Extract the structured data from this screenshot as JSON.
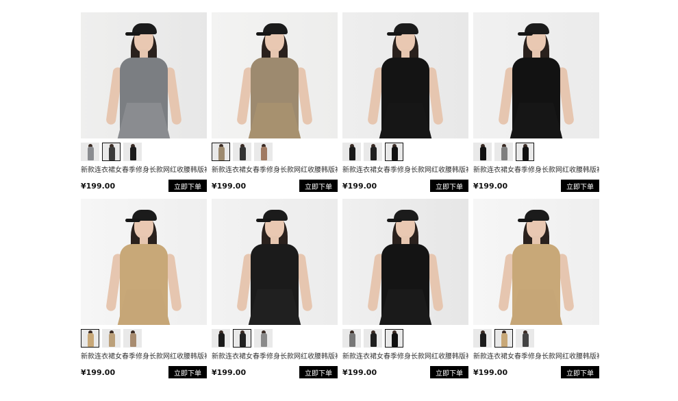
{
  "products": [
    {
      "title": "新款连衣裙女春季修身长款网红收腰韩版裙...",
      "price": "¥199.00",
      "buy_label": "立即下单",
      "bg": "#e7e7e7",
      "wall": "#efefee",
      "dress": "#7b7e82",
      "skirt": "#8a8c90",
      "thumbs": [
        "#8a8c90",
        "#3b3b3b",
        "#1a1a1a"
      ],
      "active_thumb": 1
    },
    {
      "title": "新款连衣裙女春季修身长款网红收腰韩版裙...",
      "price": "¥199.00",
      "buy_label": "立即下单",
      "bg": "#ededec",
      "wall": "#f3f3f2",
      "dress": "#9d8a6f",
      "skirt": "#a7916f",
      "thumbs": [
        "#9d8a6f",
        "#333333",
        "#a07a62"
      ],
      "active_thumb": 0
    },
    {
      "title": "新款连衣裙女春季修身长款网红收腰韩版裙...",
      "price": "¥199.00",
      "buy_label": "立即下单",
      "bg": "#e8e8e8",
      "wall": "#eeeeee",
      "dress": "#141414",
      "skirt": "#161616",
      "thumbs": [
        "#1a1a1a",
        "#202020",
        "#111111"
      ],
      "active_thumb": 2
    },
    {
      "title": "新款连衣裙女春季修身长款网红收腰韩版裙...",
      "price": "¥199.00",
      "buy_label": "立即下单",
      "bg": "#ebebeb",
      "wall": "#f1f1f1",
      "dress": "#121212",
      "skirt": "#161616",
      "thumbs": [
        "#121212",
        "#7f7f7f",
        "#111111"
      ],
      "active_thumb": 2
    },
    {
      "title": "新款连衣裙女春季修身长款网红收腰韩版裙...",
      "price": "¥199.00",
      "buy_label": "立即下单",
      "bg": "#efefef",
      "wall": "#f6f6f6",
      "dress": "#c8a878",
      "skirt": "#c6a677",
      "thumbs": [
        "#c8a878",
        "#bba07a",
        "#a88c70"
      ],
      "active_thumb": 0
    },
    {
      "title": "新款连衣裙女春季修身长款网红收腰韩版裙...",
      "price": "¥199.00",
      "buy_label": "立即下单",
      "bg": "#ececec",
      "wall": "#f2f2f2",
      "dress": "#1b1b1b",
      "skirt": "#202020",
      "thumbs": [
        "#1b1b1b",
        "#222222",
        "#8a8a8a"
      ],
      "active_thumb": 1
    },
    {
      "title": "新款连衣裙女春季修身长款网红收腰韩版裙...",
      "price": "¥199.00",
      "buy_label": "立即下单",
      "bg": "#e6e6e6",
      "wall": "#f0f0f0",
      "dress": "#141414",
      "skirt": "#1a1a1a",
      "thumbs": [
        "#777777",
        "#1f1f1f",
        "#111111"
      ],
      "active_thumb": 2
    },
    {
      "title": "新款连衣裙女春季修身长款网红收腰韩版裙...",
      "price": "¥199.00",
      "buy_label": "立即下单",
      "bg": "#efefef",
      "wall": "#f6f6f6",
      "dress": "#c8a878",
      "skirt": "#c6a677",
      "thumbs": [
        "#1c1c1c",
        "#c8a878",
        "#444444"
      ],
      "active_thumb": 1
    }
  ]
}
